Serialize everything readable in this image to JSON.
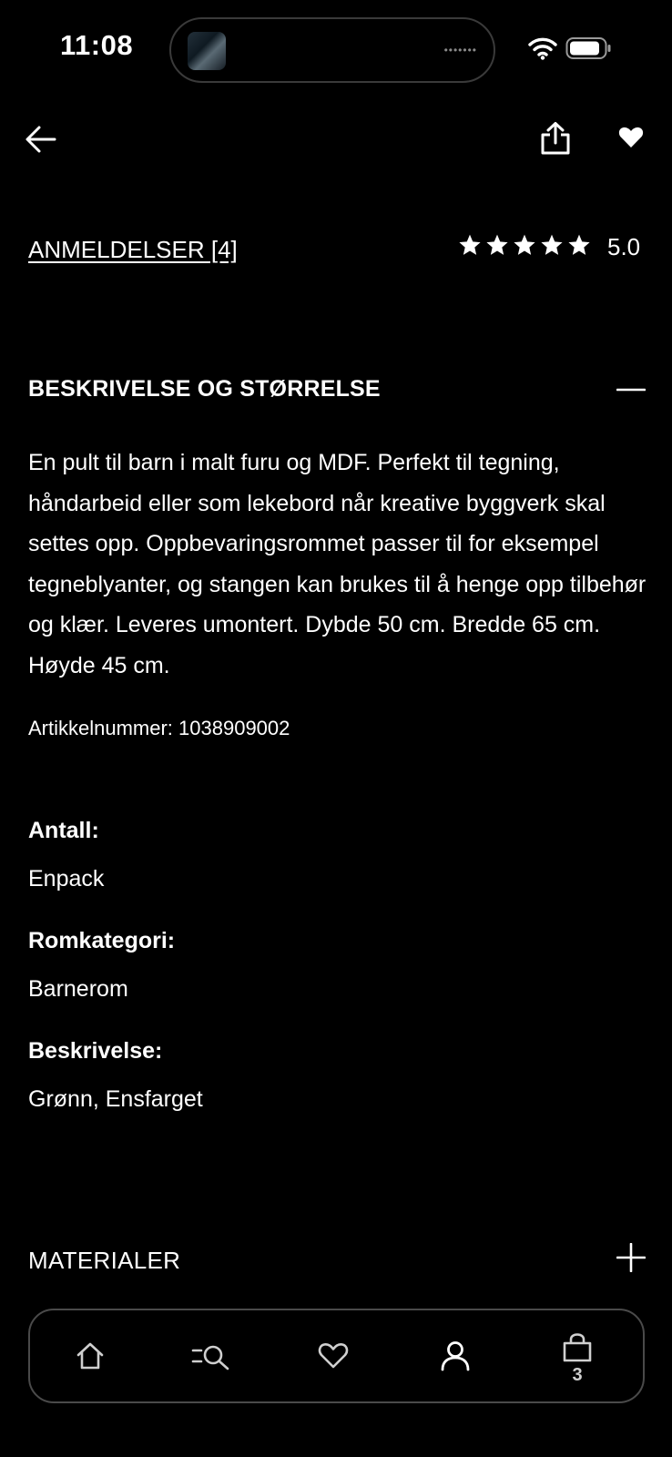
{
  "status_bar": {
    "time": "11:08"
  },
  "header": {
    "back_icon": "arrow-left-icon",
    "share_icon": "share-icon",
    "favorite_icon": "heart-icon"
  },
  "reviews": {
    "link_label": "ANMELDELSER [4]",
    "stars": 5,
    "rating": "5.0"
  },
  "description": {
    "title": "BESKRIVELSE OG STØRRELSE",
    "text": "En pult til barn i malt furu og MDF. Perfekt til tegning, håndarbeid eller som lekebord når kreative byggverk skal settes opp. Oppbevaringsrommet passer til for eksempel tegneblyanter, og stangen kan brukes til å henge opp tilbehør og klær. Leveres umontert. Dybde 50 cm. Bredde 65 cm. Høyde 45 cm.",
    "article_number": "Artikkelnummer: 1038909002",
    "attributes": [
      {
        "label": "Antall:",
        "value": "Enpack"
      },
      {
        "label": "Romkategori:",
        "value": "Barnerom"
      },
      {
        "label": "Beskrivelse:",
        "value": "Grønn, Ensfarget"
      }
    ]
  },
  "materials": {
    "title": "MATERIALER"
  },
  "tabbar": {
    "items": [
      {
        "icon": "home-icon"
      },
      {
        "icon": "search-icon"
      },
      {
        "icon": "heart-outline-icon"
      },
      {
        "icon": "user-icon"
      },
      {
        "icon": "bag-icon",
        "badge": "3"
      }
    ]
  },
  "colors": {
    "background": "#000000",
    "text": "#ffffff",
    "border": "#4a4a4a"
  }
}
